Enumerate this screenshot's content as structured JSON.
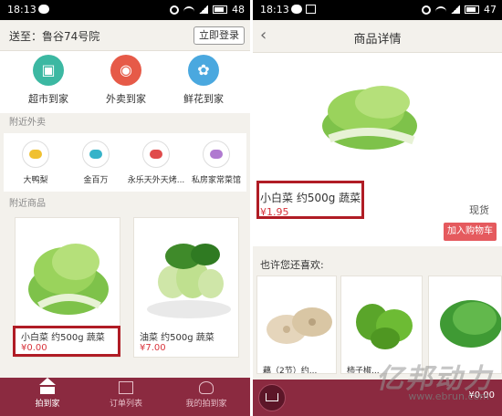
{
  "colors": {
    "accent": "#8b2a40",
    "price": "#d8343c",
    "highlight": "#b01c25",
    "cart_button": "#e55a5e"
  },
  "panel1": {
    "status": {
      "time": "18:13",
      "battery": "48"
    },
    "address": "送至：鲁谷74号院",
    "login_label": "立即登录",
    "categories": [
      {
        "label": "超市到家",
        "icon": "shopping-bag-icon"
      },
      {
        "label": "外卖到家",
        "icon": "pizza-icon"
      },
      {
        "label": "鲜花到家",
        "icon": "flower-icon"
      }
    ],
    "nearby_takeout_label": "附近外卖",
    "shops": [
      {
        "label": "大鸭梨",
        "icon": "dish-cover-icon"
      },
      {
        "label": "金百万",
        "icon": "fork-knife-icon"
      },
      {
        "label": "永乐天外天烤...",
        "icon": "chopsticks-bowl-icon"
      },
      {
        "label": "私房家常菜馆",
        "icon": "hot-bowl-icon"
      }
    ],
    "nearby_goods_label": "附近商品",
    "goods": [
      {
        "name": "小白菜 约500g 蔬菜",
        "price": "¥0.00"
      },
      {
        "name": "油菜 约500g 蔬菜",
        "price": "¥7.00"
      }
    ],
    "tabs": [
      {
        "label": "拍到家",
        "icon": "home-icon"
      },
      {
        "label": "订单列表",
        "icon": "order-list-icon"
      },
      {
        "label": "我的拍到家",
        "icon": "user-icon"
      }
    ]
  },
  "panel2": {
    "status": {
      "time": "18:13",
      "battery": "47"
    },
    "title": "商品详情",
    "product": {
      "name": "小白菜 约500g 蔬菜",
      "price": "¥1.95",
      "stock": "现货"
    },
    "add_to_cart_label": "加入购物车",
    "maybe_like_label": "也许您还喜欢:",
    "recommendations": [
      {
        "name": "藕（2节）约..."
      },
      {
        "name": "柿子椒..."
      },
      {
        "name": ""
      }
    ],
    "cart_total": "¥0.00"
  },
  "watermark": {
    "brand": "亿邦动力",
    "url": "www.ebrun.com"
  }
}
